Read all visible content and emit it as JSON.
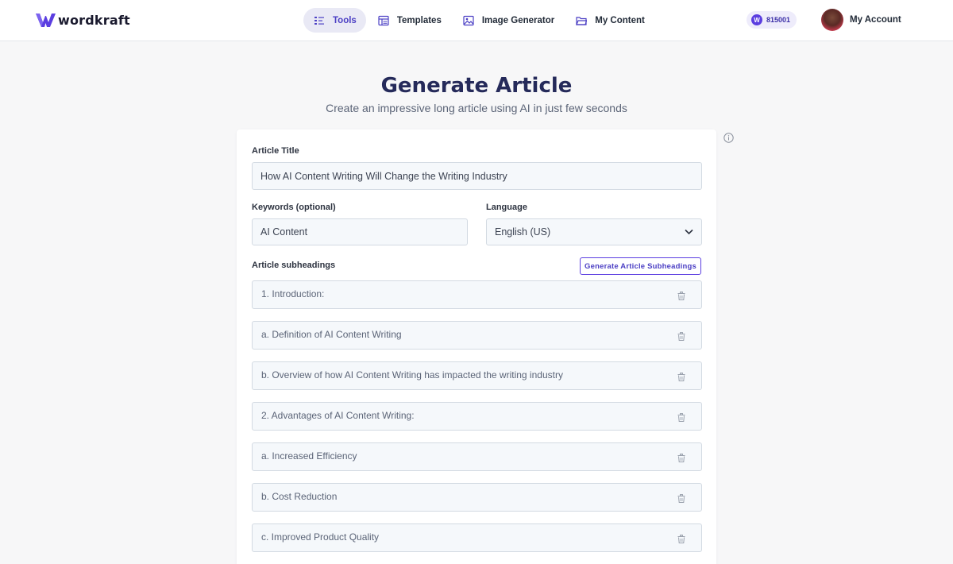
{
  "brand": {
    "name": "wordkraft"
  },
  "nav": {
    "items": [
      {
        "label": "Tools",
        "icon": "tools-icon",
        "active": true
      },
      {
        "label": "Templates",
        "icon": "templates-icon",
        "active": false
      },
      {
        "label": "Image Generator",
        "icon": "image-icon",
        "active": false
      },
      {
        "label": "My Content",
        "icon": "folder-icon",
        "active": false
      }
    ],
    "credits": {
      "badge": "W",
      "value": "815001"
    },
    "account_label": "My Account"
  },
  "page": {
    "title": "Generate Article",
    "subtitle": "Create an impressive long article using AI in just few seconds"
  },
  "form": {
    "article_title": {
      "label": "Article Title",
      "value": "How AI Content Writing Will Change the Writing Industry"
    },
    "keywords": {
      "label": "Keywords (optional)",
      "value": "AI Content"
    },
    "language": {
      "label": "Language",
      "value": "English (US)"
    },
    "subheadings": {
      "label": "Article subheadings",
      "generate_button": "Generate Article Subheadings",
      "items": [
        "1. Introduction:",
        "a. Definition of AI Content Writing",
        "b. Overview of how AI Content Writing has impacted the writing industry",
        "2. Advantages of AI Content Writing:",
        "a. Increased Efficiency",
        "b. Cost Reduction",
        "c. Improved Product Quality"
      ]
    }
  },
  "colors": {
    "accent": "#5b3ee0",
    "title": "#252a5a",
    "background": "#f7f7f8"
  }
}
